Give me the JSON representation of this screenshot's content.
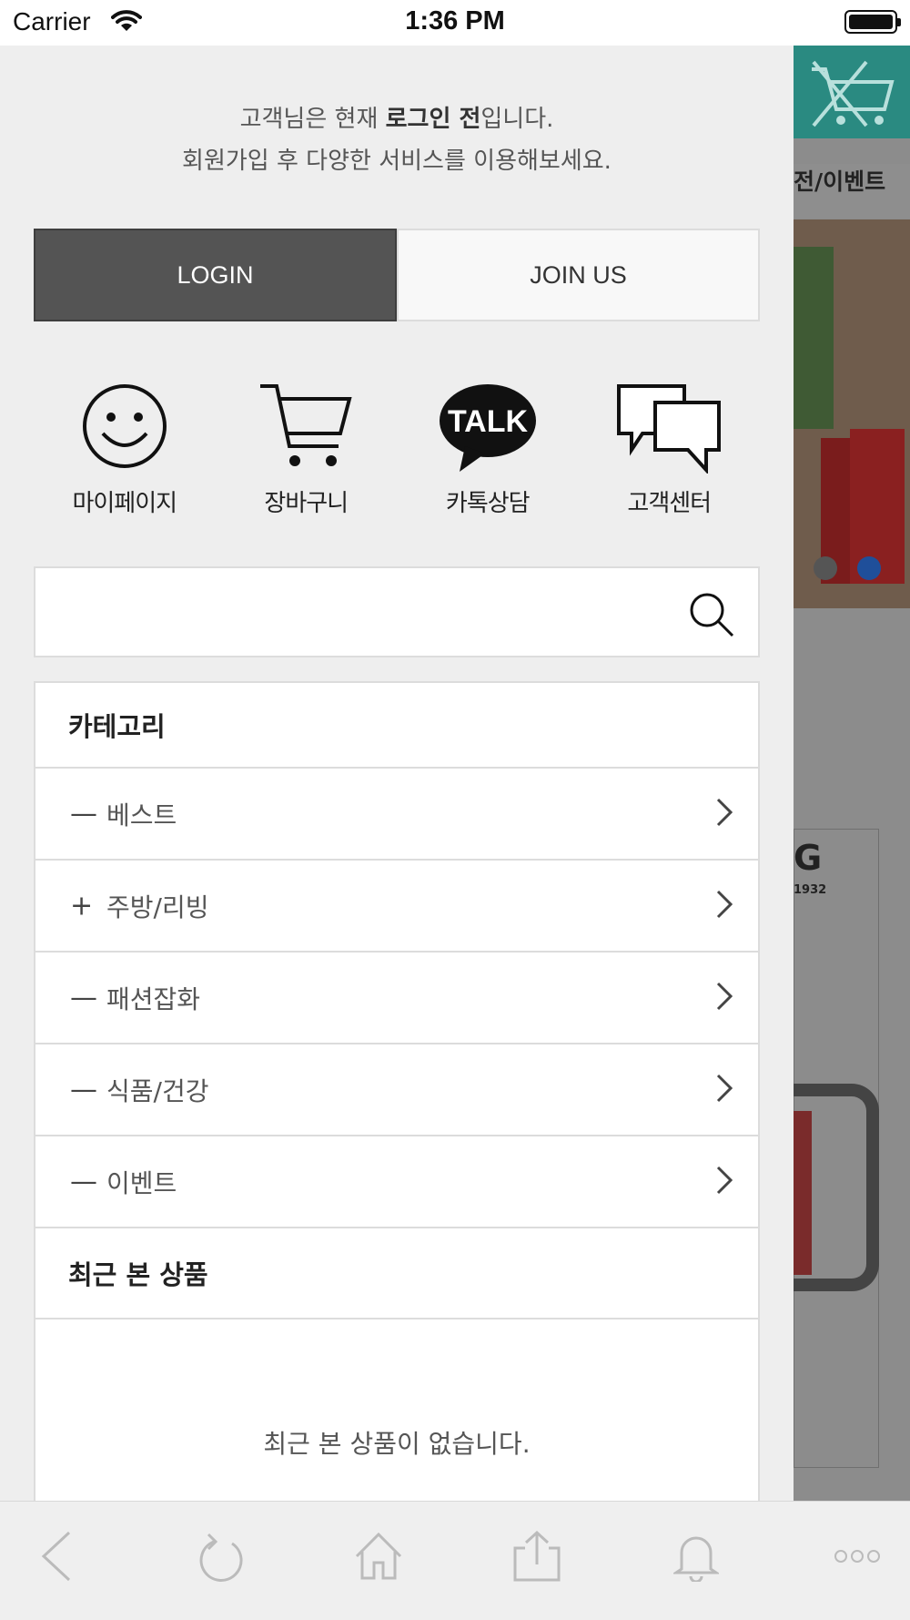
{
  "status_bar": {
    "carrier": "Carrier",
    "time": "1:36 PM"
  },
  "background_page": {
    "tab_text": "전/이벤트",
    "brand": "G",
    "brand_year": "1932"
  },
  "drawer": {
    "notice": {
      "prefix": "고객님은 현재 ",
      "bold": "로그인 전",
      "suffix": "입니다.",
      "line2": "회원가입 후 다양한 서비스를 이용해보세요."
    },
    "login_label": "LOGIN",
    "join_label": "JOIN US",
    "quick_links": [
      {
        "label": "마이페이지",
        "icon": "smiley-icon"
      },
      {
        "label": "장바구니",
        "icon": "cart-icon"
      },
      {
        "label": "카톡상담",
        "icon": "kakao-talk-icon"
      },
      {
        "label": "고객센터",
        "icon": "chat-bubbles-icon"
      }
    ],
    "talk_text": "TALK",
    "search": {
      "value": "",
      "placeholder": ""
    },
    "category_title": "카테고리",
    "categories": [
      {
        "sign": "—",
        "label": "베스트"
      },
      {
        "sign": "+",
        "label": "주방/리빙"
      },
      {
        "sign": "—",
        "label": "패션잡화"
      },
      {
        "sign": "—",
        "label": "식품/건강"
      },
      {
        "sign": "—",
        "label": "이벤트"
      }
    ],
    "recent_title": "최근 본 상품",
    "recent_empty": "최근 본 상품이 없습니다."
  },
  "toolbar": [
    "back-icon",
    "refresh-icon",
    "home-icon",
    "share-icon",
    "bell-icon",
    "more-icon"
  ],
  "colors": {
    "login_bg": "#545454",
    "drawer_bg": "#eeeeee",
    "cart_bar": "#2a8a81"
  }
}
